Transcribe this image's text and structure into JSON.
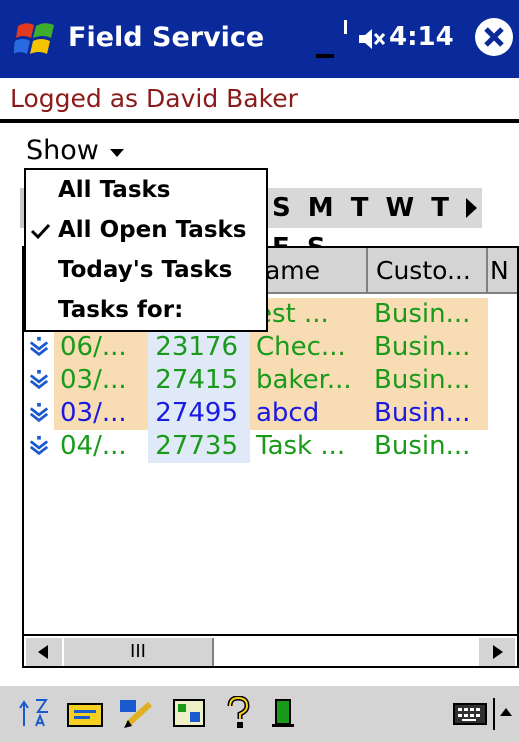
{
  "titlebar": {
    "app_title": "Field Service",
    "time": "4:14",
    "start_icon": "windows-start-icon",
    "signal_icon": "antenna-icon",
    "volume_icon": "speaker-muted-icon",
    "close_icon": "close-icon"
  },
  "user": {
    "logged_label": "Logged as David Baker"
  },
  "filter": {
    "show_label": "Show",
    "menu": [
      {
        "label": "All Tasks",
        "checked": false
      },
      {
        "label": "All Open Tasks",
        "checked": true
      },
      {
        "label": "Today's Tasks",
        "checked": false
      },
      {
        "label": "Tasks for:",
        "checked": false
      }
    ]
  },
  "days": {
    "letters": "S M T W T F S"
  },
  "table": {
    "headers": [
      "lame",
      "Custo...",
      "N"
    ],
    "rows": [
      {
        "icon": "",
        "date": "",
        "id": "",
        "name": "est ...",
        "customer": "Busin...",
        "text_color": "#1a9a1a",
        "bg": "#f7dcb4"
      },
      {
        "icon": "priority-icon",
        "date": "06/...",
        "id": "23176",
        "name": "Chec...",
        "customer": "Busin...",
        "text_color": "#1a9a1a",
        "bg": "#f7dcb4"
      },
      {
        "icon": "priority-icon",
        "date": "03/...",
        "id": "27415",
        "name": "baker...",
        "customer": "Busin...",
        "text_color": "#1a9a1a",
        "bg": "#f7dcb4"
      },
      {
        "icon": "priority-icon",
        "date": "03/...",
        "id": "27495",
        "name": "abcd",
        "customer": "Busin...",
        "text_color": "#1a1ae0",
        "bg": "#f7dcb4"
      },
      {
        "icon": "priority-icon",
        "date": "04/...",
        "id": "27735",
        "name": "Task ...",
        "customer": "Busin...",
        "text_color": "#1a9a1a",
        "bg": "#ffffff"
      }
    ]
  },
  "scrollbar": {
    "thumb_glyph": "III"
  },
  "toolbar": {
    "icons": [
      "sort-icon",
      "message-icon",
      "edit-icon",
      "map-icon",
      "help-icon",
      "exit-door-icon",
      "keyboard-icon",
      "menu-up-arrow-icon"
    ]
  },
  "colors": {
    "titlebar": "#0a2a9c",
    "logged_text": "#8b1a1a",
    "row_highlight": "#f7dcb4",
    "id_column_bg": "#dfe9f7"
  }
}
